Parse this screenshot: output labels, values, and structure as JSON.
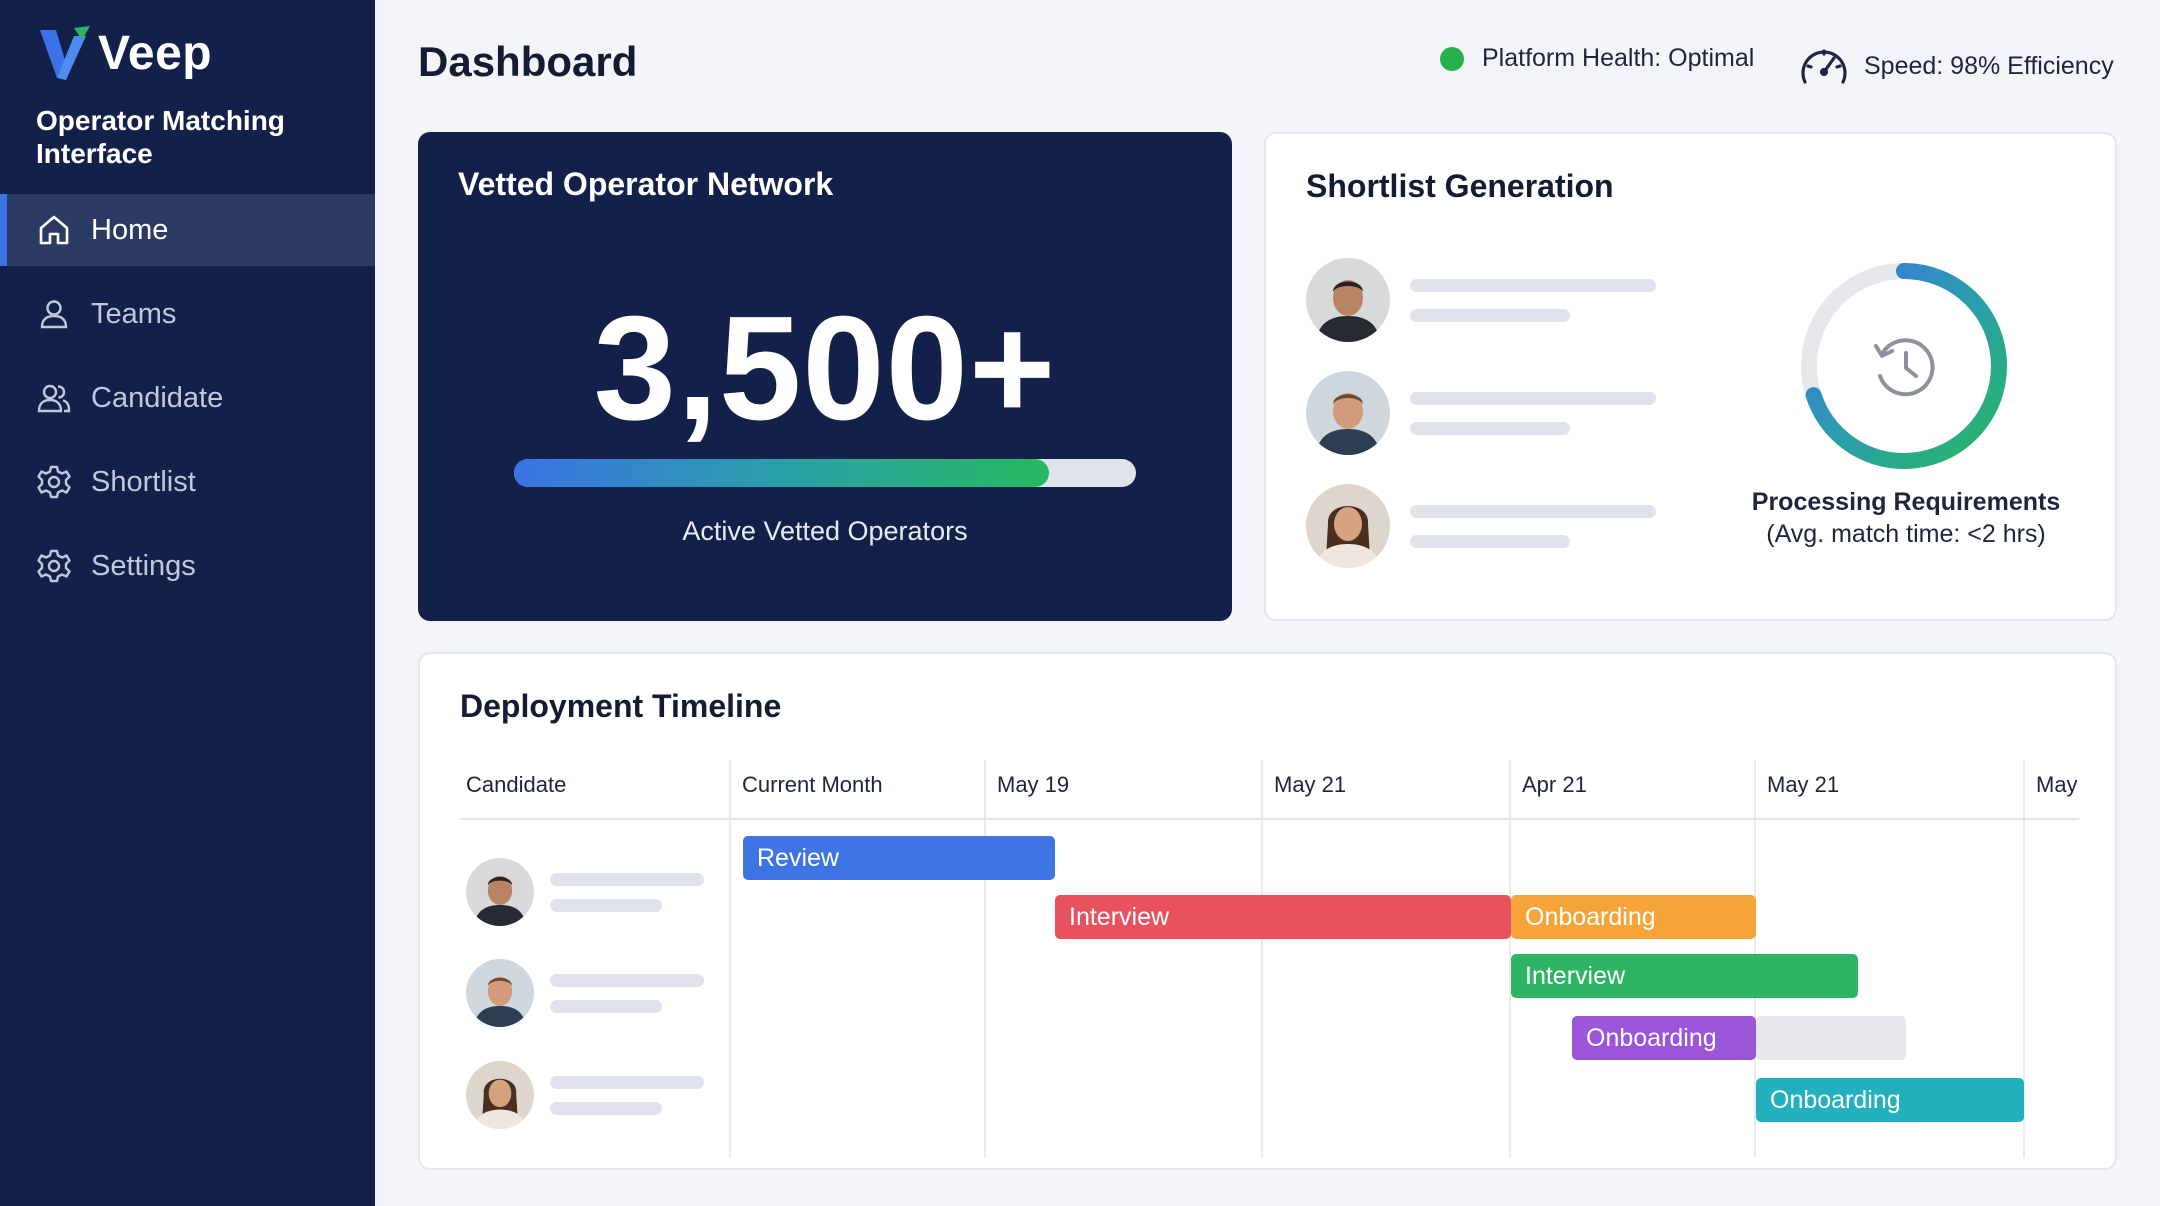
{
  "sidebar": {
    "brand": "Veep",
    "subtitle": "Operator Matching Interface",
    "items": [
      {
        "label": "Home",
        "icon": "home-icon"
      },
      {
        "label": "Teams",
        "icon": "user-icon"
      },
      {
        "label": "Candidate",
        "icon": "users-icon"
      },
      {
        "label": "Shortlist",
        "icon": "gear-icon"
      },
      {
        "label": "Settings",
        "icon": "gear-icon"
      }
    ],
    "active": "Home"
  },
  "header": {
    "title": "Dashboard",
    "health": "Platform Health: Optimal",
    "speed": "Speed: 98% Efficiency"
  },
  "network": {
    "title": "Vetted Operator Network",
    "count": "3,500+",
    "progress_fraction": 0.86,
    "caption": "Active Vetted Operators"
  },
  "shortlist": {
    "title": "Shortlist Generation",
    "ring_fraction": 0.7,
    "label_bold": "Processing Requirements",
    "label_sub": "(Avg. match time: <2 hrs)"
  },
  "timeline": {
    "title": "Deployment Timeline",
    "columns": [
      "Candidate",
      "Current Month",
      "May 19",
      "May 21",
      "Apr 21",
      "May 21",
      "May"
    ],
    "bars": [
      {
        "label": "Review",
        "color": "#3f75e2"
      },
      {
        "label": "Interview",
        "color": "#e7525e"
      },
      {
        "label": "Onboarding",
        "color": "#f5a43a"
      },
      {
        "label": "Interview",
        "color": "#2fb463"
      },
      {
        "label": "Onboarding",
        "color": "#9b55d8"
      },
      {
        "label": "",
        "color": "#e6e8ec"
      },
      {
        "label": "Onboarding",
        "color": "#23b0bf"
      }
    ]
  },
  "colors": {
    "sidebar": "#13214a",
    "accent": "#3b73e6",
    "health": "#27b14c"
  }
}
